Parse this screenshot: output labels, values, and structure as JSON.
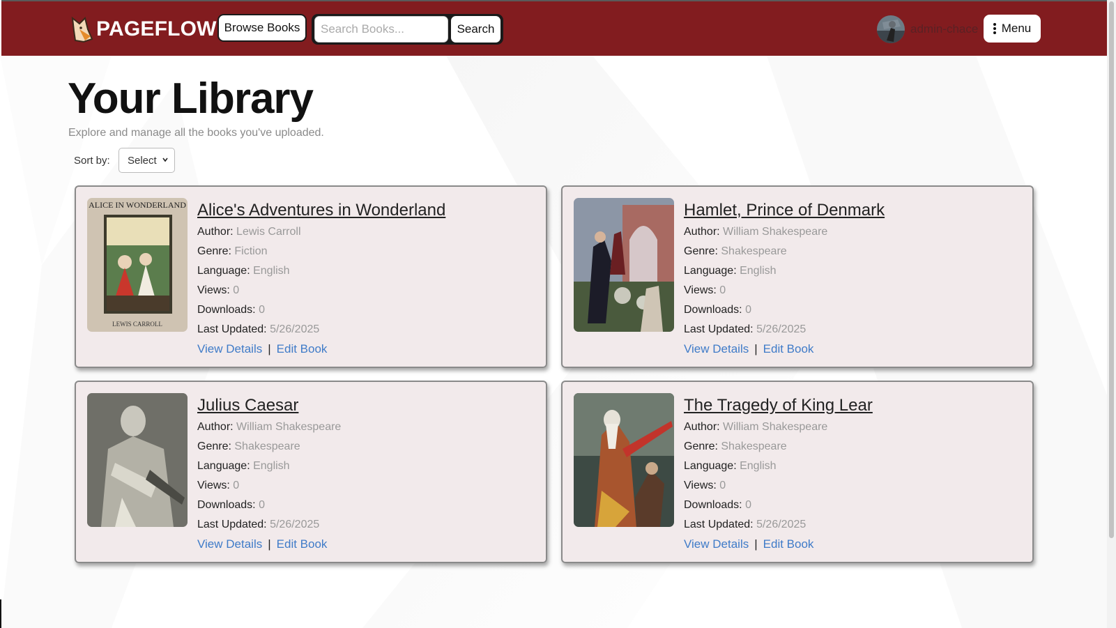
{
  "navbar": {
    "brand": "PAGEFLOW",
    "browse_label": "Browse Books",
    "search_placeholder": "Search Books...",
    "search_label": "Search",
    "username": "admin-chace",
    "menu_label": "Menu"
  },
  "page": {
    "title": "Your Library",
    "subtitle": "Explore and manage all the books you've uploaded.",
    "sort_label": "Sort by:",
    "sort_value": "Select"
  },
  "field_labels": {
    "author": "Author:",
    "genre": "Genre:",
    "language": "Language:",
    "views": "Views:",
    "downloads": "Downloads:",
    "updated": "Last Updated:",
    "view_details": "View Details",
    "edit_book": "Edit Book",
    "separator": "|"
  },
  "books": [
    {
      "title": "Alice's Adventures in Wonderland",
      "author": "Lewis Carroll",
      "genre": "Fiction",
      "language": "English",
      "views": "0",
      "downloads": "0",
      "updated": "5/26/2025",
      "cover_text_top": "ALICE IN WONDERLAND",
      "cover_text_bottom": "LEWIS CARROLL"
    },
    {
      "title": "Hamlet, Prince of Denmark",
      "author": "William Shakespeare",
      "genre": "Shakespeare",
      "language": "English",
      "views": "0",
      "downloads": "0",
      "updated": "5/26/2025"
    },
    {
      "title": "Julius Caesar",
      "author": "William Shakespeare",
      "genre": "Shakespeare",
      "language": "English",
      "views": "0",
      "downloads": "0",
      "updated": "5/26/2025"
    },
    {
      "title": "The Tragedy of King Lear",
      "author": "William Shakespeare",
      "genre": "Shakespeare",
      "language": "English",
      "views": "0",
      "downloads": "0",
      "updated": "5/26/2025"
    }
  ],
  "colors": {
    "navbar": "#821c1f",
    "link": "#3f7bc8",
    "card_bg": "#f1e8e9"
  }
}
